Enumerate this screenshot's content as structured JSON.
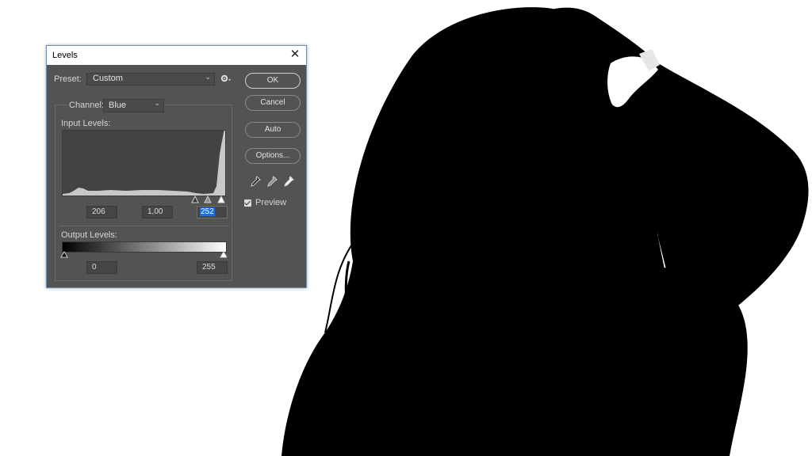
{
  "dialog": {
    "title": "Levels",
    "close_icon": "close-icon"
  },
  "preset": {
    "label": "Preset:",
    "value": "Custom",
    "settings_icon": "gear-icon"
  },
  "channel": {
    "label": "Channel:",
    "value": "Blue"
  },
  "input_levels": {
    "label": "Input Levels:",
    "black": "206",
    "gamma": "1,00",
    "white": "252"
  },
  "output_levels": {
    "label": "Output Levels:",
    "black": "0",
    "white": "255"
  },
  "buttons": {
    "ok": "OK",
    "cancel": "Cancel",
    "auto": "Auto",
    "options": "Options..."
  },
  "eyedroppers": [
    "black-point-eyedropper-icon",
    "gray-point-eyedropper-icon",
    "white-point-eyedropper-icon"
  ],
  "preview": {
    "label": "Preview",
    "checked": true
  },
  "colors": {
    "dialog_bg": "#535353",
    "field_bg": "#454545",
    "selection": "#1e6ed8",
    "histogram_fill": "#c8c8c8"
  }
}
